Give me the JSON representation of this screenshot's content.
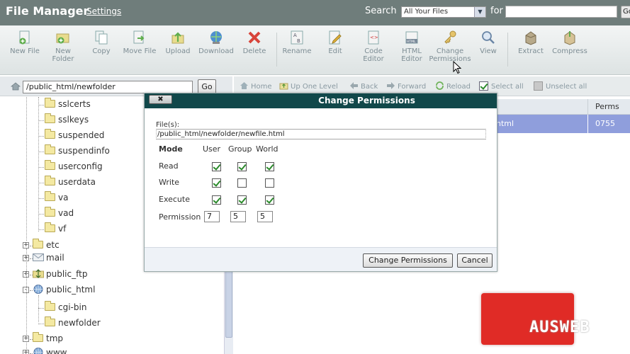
{
  "header": {
    "title": "File Manager",
    "settings": "Settings",
    "search_label": "Search",
    "search_scope": "All Your Files",
    "for_label": "for",
    "search_value": "",
    "go": "Go"
  },
  "toolbar": [
    {
      "label": "New File",
      "icon": "new-file-icon"
    },
    {
      "label": "New\nFolder",
      "icon": "new-folder-icon"
    },
    {
      "label": "Copy",
      "icon": "copy-icon"
    },
    {
      "label": "Move File",
      "icon": "move-file-icon"
    },
    {
      "label": "Upload",
      "icon": "upload-icon"
    },
    {
      "label": "Download",
      "icon": "download-icon"
    },
    {
      "label": "Delete",
      "icon": "delete-icon"
    },
    {
      "label": "Rename",
      "icon": "rename-icon"
    },
    {
      "label": "Edit",
      "icon": "edit-icon"
    },
    {
      "label": "Code\nEditor",
      "icon": "code-editor-icon"
    },
    {
      "label": "HTML\nEditor",
      "icon": "html-editor-icon"
    },
    {
      "label": "Change\nPermissions",
      "icon": "change-permissions-icon"
    },
    {
      "label": "View",
      "icon": "view-icon"
    },
    {
      "label": "Extract",
      "icon": "extract-icon"
    },
    {
      "label": "Compress",
      "icon": "compress-icon"
    }
  ],
  "pathbar": {
    "path": "/public_html/newfolder",
    "go": "Go"
  },
  "nav": {
    "home": "Home",
    "up_one_level": "Up One Level",
    "back": "Back",
    "forward": "Forward",
    "reload": "Reload",
    "select_all": "Select all",
    "unselect_all": "Unselect all"
  },
  "tree": {
    "nested": [
      "sslcerts",
      "sslkeys",
      "suspended",
      "suspendinfo",
      "userconfig",
      "userdata",
      "va",
      "vad",
      "vf"
    ],
    "top": [
      {
        "label": "etc",
        "kind": "folder"
      },
      {
        "label": "mail",
        "kind": "mail"
      },
      {
        "label": "public_ftp",
        "kind": "ftp"
      },
      {
        "label": "public_html",
        "kind": "web"
      }
    ],
    "public_html_children": [
      "cgi-bin",
      "newfolder"
    ],
    "after": [
      {
        "label": "tmp",
        "kind": "folder"
      },
      {
        "label": "www",
        "kind": "web"
      }
    ]
  },
  "list": {
    "perms_header": "Perms",
    "row_name": "html",
    "row_perms": "0755"
  },
  "dialog": {
    "title": "Change Permissions",
    "close": "✖",
    "files_label": "File(s):",
    "files_value": "/public_html/newfolder/newfile.html",
    "mode_label": "Mode",
    "columns": [
      "User",
      "Group",
      "World"
    ],
    "rows": [
      {
        "label": "Read",
        "checks": [
          true,
          true,
          true
        ]
      },
      {
        "label": "Write",
        "checks": [
          true,
          false,
          false
        ]
      },
      {
        "label": "Execute",
        "checks": [
          true,
          true,
          true
        ]
      }
    ],
    "permission_label": "Permission",
    "permission_values": [
      "7",
      "5",
      "5"
    ],
    "ok_button": "Change Permissions",
    "cancel_button": "Cancel"
  },
  "logo": {
    "text": "AUSWEB"
  },
  "colors": {
    "header_bg": "#6f7d7b",
    "dialog_title_bg": "#11484a",
    "selected_row": "#8f9edc",
    "logo_red": "#e02b26"
  }
}
